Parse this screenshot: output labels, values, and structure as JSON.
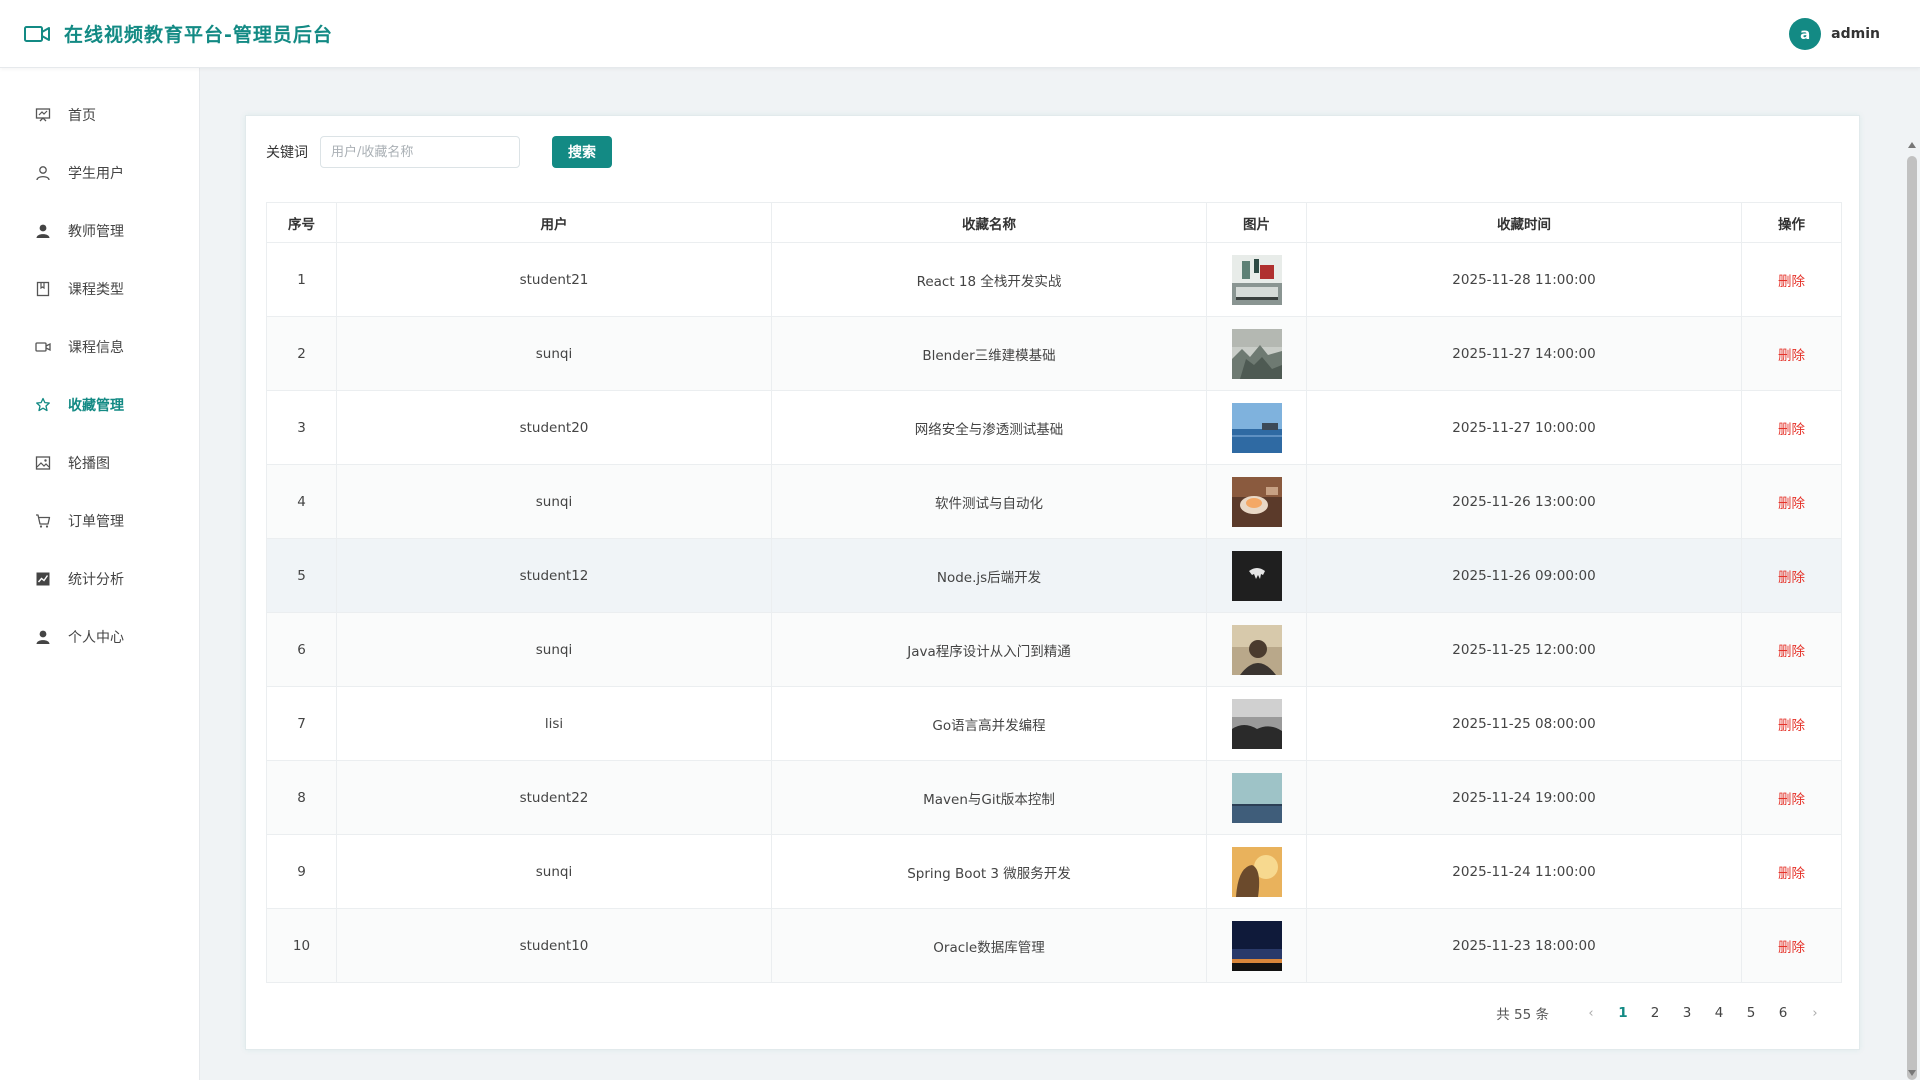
{
  "header": {
    "title": "在线视频教育平台-管理员后台",
    "avatar_letter": "a",
    "username": "admin"
  },
  "sidebar": {
    "items": [
      {
        "label": "首页",
        "icon": "monitor-icon"
      },
      {
        "label": "学生用户",
        "icon": "user-outline-icon"
      },
      {
        "label": "教师管理",
        "icon": "user-filled-icon"
      },
      {
        "label": "课程类型",
        "icon": "notebook-icon"
      },
      {
        "label": "课程信息",
        "icon": "video-camera-icon"
      },
      {
        "label": "收藏管理",
        "icon": "star-icon",
        "active": true
      },
      {
        "label": "轮播图",
        "icon": "picture-icon"
      },
      {
        "label": "订单管理",
        "icon": "cart-icon"
      },
      {
        "label": "统计分析",
        "icon": "chart-icon"
      },
      {
        "label": "个人中心",
        "icon": "user-filled-icon"
      }
    ]
  },
  "search": {
    "label": "关键词",
    "placeholder": "用户/收藏名称",
    "value": "",
    "button": "搜索"
  },
  "table": {
    "columns": [
      "序号",
      "用户",
      "收藏名称",
      "图片",
      "收藏时间",
      "操作"
    ],
    "rows": [
      {
        "no": "1",
        "user": "student21",
        "name": "React 18 全栈开发实战",
        "time": "2025-11-28 11:00:00",
        "action": "删除"
      },
      {
        "no": "2",
        "user": "sunqi",
        "name": "Blender三维建模基础",
        "time": "2025-11-27 14:00:00",
        "action": "删除"
      },
      {
        "no": "3",
        "user": "student20",
        "name": "网络安全与渗透测试基础",
        "time": "2025-11-27 10:00:00",
        "action": "删除"
      },
      {
        "no": "4",
        "user": "sunqi",
        "name": "软件测试与自动化",
        "time": "2025-11-26 13:00:00",
        "action": "删除"
      },
      {
        "no": "5",
        "user": "student12",
        "name": "Node.js后端开发",
        "time": "2025-11-26 09:00:00",
        "action": "删除"
      },
      {
        "no": "6",
        "user": "sunqi",
        "name": "Java程序设计从入门到精通",
        "time": "2025-11-25 12:00:00",
        "action": "删除"
      },
      {
        "no": "7",
        "user": "lisi",
        "name": "Go语言高并发编程",
        "time": "2025-11-25 08:00:00",
        "action": "删除"
      },
      {
        "no": "8",
        "user": "student22",
        "name": "Maven与Git版本控制",
        "time": "2025-11-24 19:00:00",
        "action": "删除"
      },
      {
        "no": "9",
        "user": "sunqi",
        "name": "Spring Boot 3 微服务开发",
        "time": "2025-11-24 11:00:00",
        "action": "删除"
      },
      {
        "no": "10",
        "user": "student10",
        "name": "Oracle数据库管理",
        "time": "2025-11-23 18:00:00",
        "action": "删除"
      }
    ],
    "highlighted_row": 5
  },
  "pagination": {
    "total_text": "共 55 条",
    "pages": [
      "1",
      "2",
      "3",
      "4",
      "5",
      "6"
    ],
    "current": "1"
  },
  "colors": {
    "accent": "#138a84",
    "danger": "#e5332a"
  }
}
